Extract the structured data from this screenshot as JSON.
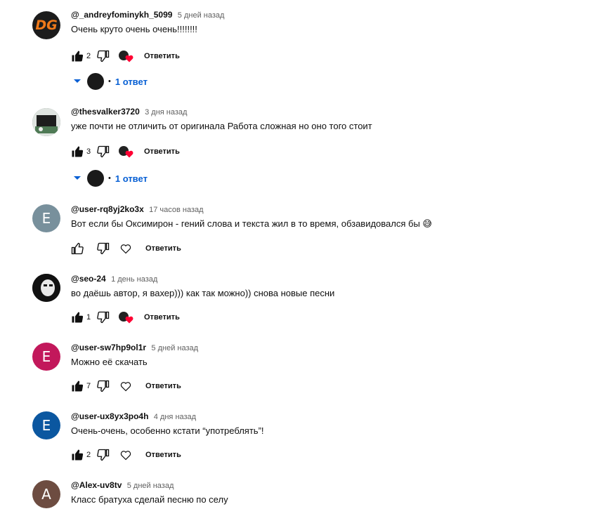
{
  "comments": [
    {
      "author": "@_andreyfominykh_5099",
      "time": "5 дней назад",
      "text": "Очень круто очень очень!!!!!!!!",
      "likes": "2",
      "avatar": {
        "kind": "logo",
        "letters": "DG",
        "bg": "#1c1c1c",
        "fg": "#f07a1a"
      },
      "hearted": true,
      "reply_label": "Ответить",
      "replies": "1 ответ"
    },
    {
      "author": "@thesvalker3720",
      "time": "3 дня назад",
      "text": "уже почти не отличить от оригинала Работа сложная но оно того стоит",
      "likes": "3",
      "avatar": {
        "kind": "photo",
        "bg": "#5a6a60"
      },
      "hearted": true,
      "reply_label": "Ответить",
      "replies": "1 ответ"
    },
    {
      "author": "@user-rq8yj2ko3x",
      "time": "17 часов назад",
      "text": "Вот если бы Оксимирон - гений слова и текста жил в то время, обзавидовался бы 😅",
      "likes": "",
      "avatar": {
        "kind": "letter",
        "letter": "E",
        "bg": "#78909c"
      },
      "hearted": false,
      "reply_label": "Ответить"
    },
    {
      "author": "@seo-24",
      "time": "1 день назад",
      "text": "во даёшь автор, я вахер))) как так можно)) снова новые песни",
      "likes": "1",
      "avatar": {
        "kind": "photo",
        "bg": "#111111"
      },
      "hearted": true,
      "reply_label": "Ответить"
    },
    {
      "author": "@user-sw7hp9ol1r",
      "time": "5 дней назад",
      "text": "Можно её скачать",
      "likes": "7",
      "avatar": {
        "kind": "letter",
        "letter": "E",
        "bg": "#c2185b"
      },
      "hearted": false,
      "reply_label": "Ответить"
    },
    {
      "author": "@user-ux8yx3po4h",
      "time": "4 дня назад",
      "text": "Очень-очень, особенно кстати “употреблять”!",
      "likes": "2",
      "avatar": {
        "kind": "letter",
        "letter": "E",
        "bg": "#0b57a0"
      },
      "hearted": false,
      "reply_label": "Ответить"
    },
    {
      "author": "@Alex-uv8tv",
      "time": "5 дней назад",
      "text": "Класс братуха сделай песню по селу",
      "avatar": {
        "kind": "letter",
        "letter": "A",
        "bg": "#6d4c41"
      }
    }
  ],
  "icons": {
    "like": "thumb-up-icon",
    "dislike": "thumb-down-icon",
    "heart": "heart-icon",
    "expand": "chevron-down-icon"
  },
  "colors": {
    "link": "#065fd4",
    "heart": "#ff0033"
  }
}
